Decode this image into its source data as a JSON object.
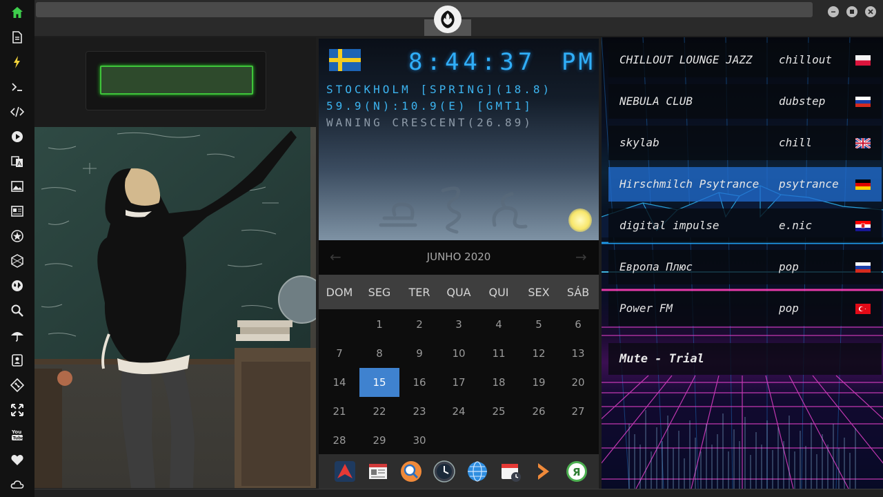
{
  "sidebar": {
    "icons": [
      "home-icon",
      "document-icon",
      "lightning-icon",
      "terminal-icon",
      "code-icon",
      "play-icon",
      "translate-icon",
      "image-icon",
      "news-icon",
      "star-emblem-icon",
      "hexagon-icon",
      "globe-icon",
      "search-icon",
      "umbrella-icon",
      "contact-icon",
      "git-icon",
      "expand-icon",
      "youtube-icon",
      "heart-icon",
      "cloud-icon"
    ],
    "accent": "#3ecf4c"
  },
  "weather": {
    "time": "8:44:37",
    "ampm": "PM",
    "line1": "STOCKHOLM [SPRING](18.8)",
    "line2": "59.9(N):10.9(E) [GMT1]",
    "line3": "WANING CRESCENT(26.89)",
    "flag_colors": [
      "#1d64b5",
      "#f4cc1f"
    ]
  },
  "calendar": {
    "title": "JUNHO 2020",
    "prev": "←",
    "next": "→",
    "weekdays": [
      "DOM",
      "SEG",
      "TER",
      "QUA",
      "QUI",
      "SEX",
      "SÁB"
    ],
    "weeks": [
      [
        "",
        "1",
        "2",
        "3",
        "4",
        "5",
        "6"
      ],
      [
        "7",
        "8",
        "9",
        "10",
        "11",
        "12",
        "13"
      ],
      [
        "14",
        "15",
        "16",
        "17",
        "18",
        "19",
        "20"
      ],
      [
        "21",
        "22",
        "23",
        "24",
        "25",
        "26",
        "27"
      ],
      [
        "28",
        "29",
        "30",
        "",
        "",
        "",
        ""
      ]
    ],
    "today": "15",
    "highlight_color": "#3f82cf"
  },
  "dock": {
    "apps": [
      "arrow-app-icon",
      "newspaper-app-icon",
      "magnifier-app-icon",
      "clock-app-icon",
      "globe-app-icon",
      "calendar-app-icon",
      "play-arrow-app-icon",
      "yandex-app-icon"
    ]
  },
  "radio": {
    "stations": [
      {
        "name": "CHILLOUT LOUNGE JAZZ",
        "genre": "chillout",
        "flag": "poland"
      },
      {
        "name": "NEBULA CLUB",
        "genre": "dubstep",
        "flag": "russia"
      },
      {
        "name": "skylab",
        "genre": "chill",
        "flag": "uk"
      },
      {
        "name": "Hirschmilch Psytrance",
        "genre": "psytrance",
        "flag": "germany"
      },
      {
        "name": "digital impulse",
        "genre": "e.nic",
        "flag": "croatia"
      },
      {
        "name": "Европа Плюс",
        "genre": "pop",
        "flag": "russia"
      },
      {
        "name": "Power FM",
        "genre": "pop",
        "flag": "turkey"
      }
    ],
    "active_index": 3,
    "status": "Mute - Trial"
  }
}
